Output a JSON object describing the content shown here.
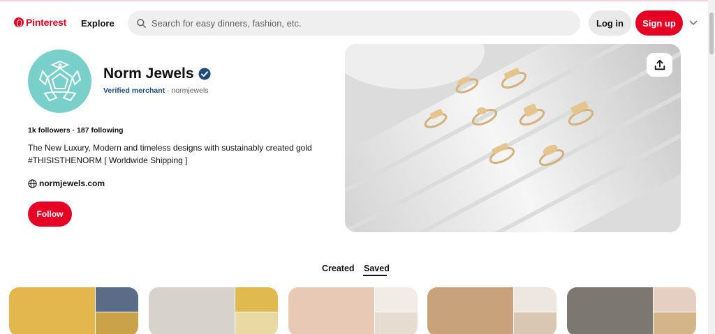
{
  "header": {
    "logo_text": "Pinterest",
    "explore_label": "Explore",
    "search_placeholder": "Search for easy dinners, fashion, etc.",
    "login_label": "Log in",
    "signup_label": "Sign up"
  },
  "profile": {
    "name": "Norm Jewels",
    "verified_label": "Verified merchant",
    "handle": "· normjewels",
    "stats": "1k followers · 187 following",
    "bio_line1": "The New Luxury, Modern and timeless designs with sustainably created gold",
    "bio_line2": "#THISISTHENORM [ Worldwide Shipping ]",
    "website": "normjewels.com",
    "follow_label": "Follow"
  },
  "tabs": [
    {
      "label": "Created",
      "active": false
    },
    {
      "label": "Saved",
      "active": true
    }
  ],
  "boards": [
    {
      "colors": [
        "#e3b64e",
        "#5a6c86",
        "#c9a24a"
      ]
    },
    {
      "colors": [
        "#d8d2cc",
        "#e0b94f",
        "#ead9a2"
      ]
    },
    {
      "colors": [
        "#e8c9b5",
        "#f1ece6",
        "#e6dccf"
      ]
    },
    {
      "colors": [
        "#c8a27a",
        "#eee7df",
        "#d9c7b3"
      ]
    },
    {
      "colors": [
        "#7c7770",
        "#e5cfc2",
        "#d4b58a"
      ]
    }
  ],
  "colors": {
    "brand": "#e60023",
    "avatar_bg": "#79d0ca",
    "verified": "#1e4c7a"
  },
  "icons": [
    "pinterest-logo-icon",
    "search-icon",
    "chevron-down-icon",
    "verified-badge-icon",
    "globe-icon",
    "share-icon"
  ]
}
